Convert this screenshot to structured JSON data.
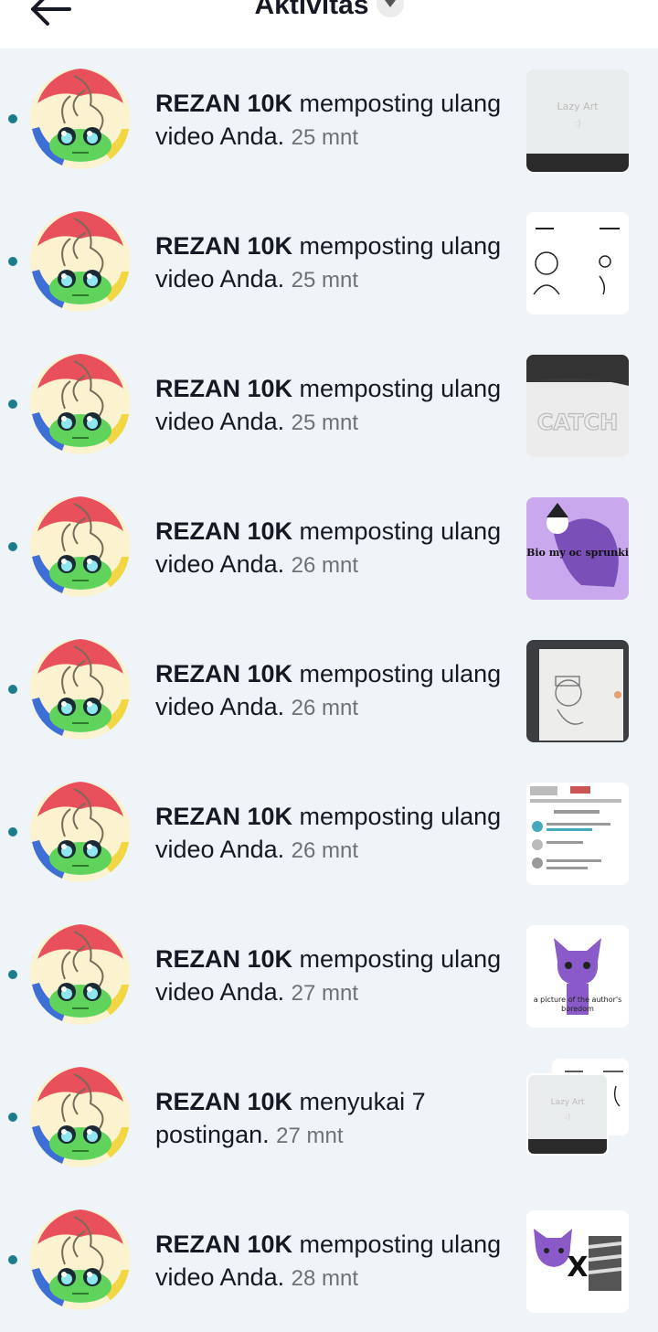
{
  "header": {
    "title": "Aktivitas"
  },
  "notifications": [
    {
      "user": "REZAN 10K",
      "action": " memposting ulang video Anda.",
      "time": "25 mnt",
      "thumb": "lazy-art"
    },
    {
      "user": "REZAN 10K",
      "action": " memposting ulang video Anda.",
      "time": "25 mnt",
      "thumb": "sketch-duo"
    },
    {
      "user": "REZAN 10K",
      "action": " memposting ulang video Anda.",
      "time": "25 mnt",
      "thumb": "catch"
    },
    {
      "user": "REZAN 10K",
      "action": " memposting ulang video Anda.",
      "time": "26 mnt",
      "thumb": "purple-oc",
      "thumb_text": "Bio my oc sprunki"
    },
    {
      "user": "REZAN 10K",
      "action": " memposting ulang video Anda.",
      "time": "26 mnt",
      "thumb": "sketch-paper"
    },
    {
      "user": "REZAN 10K",
      "action": " memposting ulang video Anda.",
      "time": "26 mnt",
      "thumb": "comments"
    },
    {
      "user": "REZAN 10K",
      "action": " memposting ulang video Anda.",
      "time": "27 mnt",
      "thumb": "purple-cat",
      "thumb_text": "a picture of the author's boredom"
    },
    {
      "user": "REZAN 10K",
      "action": " menyukai 7 postingan.",
      "time": "27 mnt",
      "thumb": "stack"
    },
    {
      "user": "REZAN 10K",
      "action": " memposting ulang video Anda.",
      "time": "28 mnt",
      "thumb": "purple-x"
    }
  ],
  "colors": {
    "background": "#eef4f7",
    "unread_dot": "#1a7d8c",
    "text": "#161823",
    "time": "#6f7177"
  },
  "icons": {
    "back": "arrow-left-icon",
    "dropdown": "caret-down-icon"
  }
}
